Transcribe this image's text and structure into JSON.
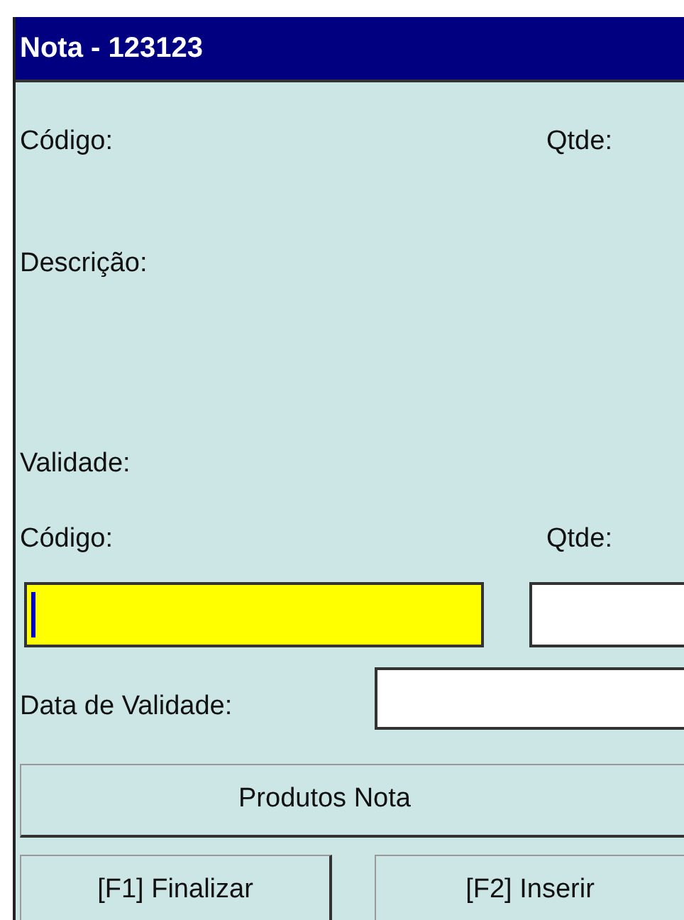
{
  "window": {
    "title": "Nota - 123123"
  },
  "info": [
    {
      "label": "Código:",
      "side_label": "Qtde:"
    },
    {
      "label": "Descrição:"
    },
    {
      "label": "Validade:"
    }
  ],
  "entry": {
    "codigo_label": "Código:",
    "qtde_label": "Qtde:",
    "codigo_focused": true,
    "validade_label": "Data de Validade:"
  },
  "list_button": "Produtos Nota",
  "buttons": [
    "[F1] Finalizar",
    "[F2] Inserir"
  ]
}
